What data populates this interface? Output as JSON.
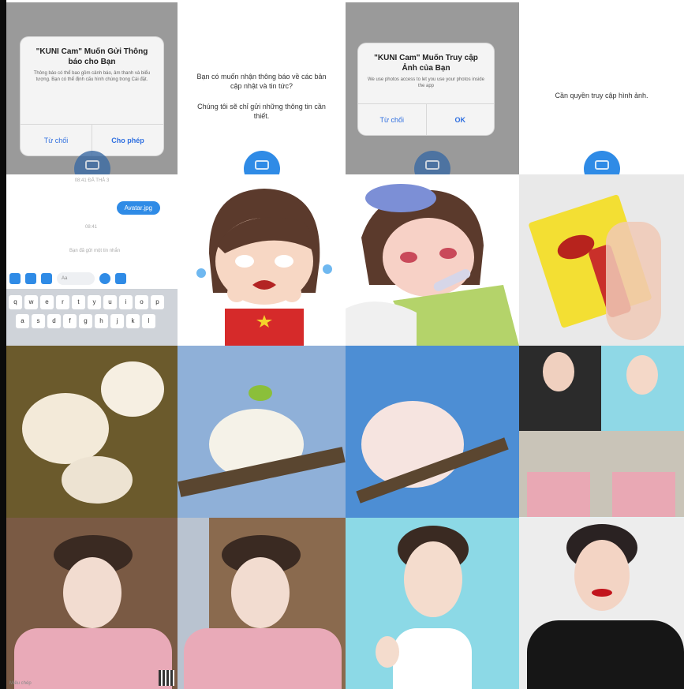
{
  "panel1": {
    "dialog_title": "\"KUNI Cam\" Muốn Gửi Thông báo cho Bạn",
    "dialog_message": "Thông báo có thể bao gồm cảnh báo, âm thanh và biểu tượng. Bạn có thể định cấu hình chúng trong Cài đặt.",
    "deny_label": "Từ chối",
    "allow_label": "Cho phép"
  },
  "panel2": {
    "line1": "Bạn có muốn nhận thông báo về các bản cập nhật và tin tức?",
    "line2": "Chúng tôi sẽ chỉ gửi những thông tin cần thiết."
  },
  "panel3": {
    "dialog_title": "\"KUNI Cam\" Muốn Truy cập Ảnh của Bạn",
    "dialog_message": "We use photos access to let you use your photos inside the app",
    "deny_label": "Từ chối",
    "allow_label": "OK"
  },
  "panel4": {
    "text": "Cần quyền truy cập hình ảnh."
  },
  "chat": {
    "timestamp": "08:41 ĐÃ THẢ 3",
    "bubble_text": "Avatar.jpg",
    "seen_text": "08:41",
    "reply_text": "Bạn đã gửi một tin nhắn",
    "input_placeholder": "Aa",
    "keyboard_row1": [
      "q",
      "w",
      "e",
      "r",
      "t",
      "y",
      "u",
      "i",
      "o",
      "p"
    ],
    "keyboard_row2": [
      "a",
      "s",
      "d",
      "f",
      "g",
      "h",
      "j",
      "k",
      "l"
    ]
  },
  "bottom": {
    "caption": "Miêu chép"
  },
  "colors": {
    "messenger_blue": "#2f8be6",
    "dialog_gray": "#9a9a9a"
  }
}
